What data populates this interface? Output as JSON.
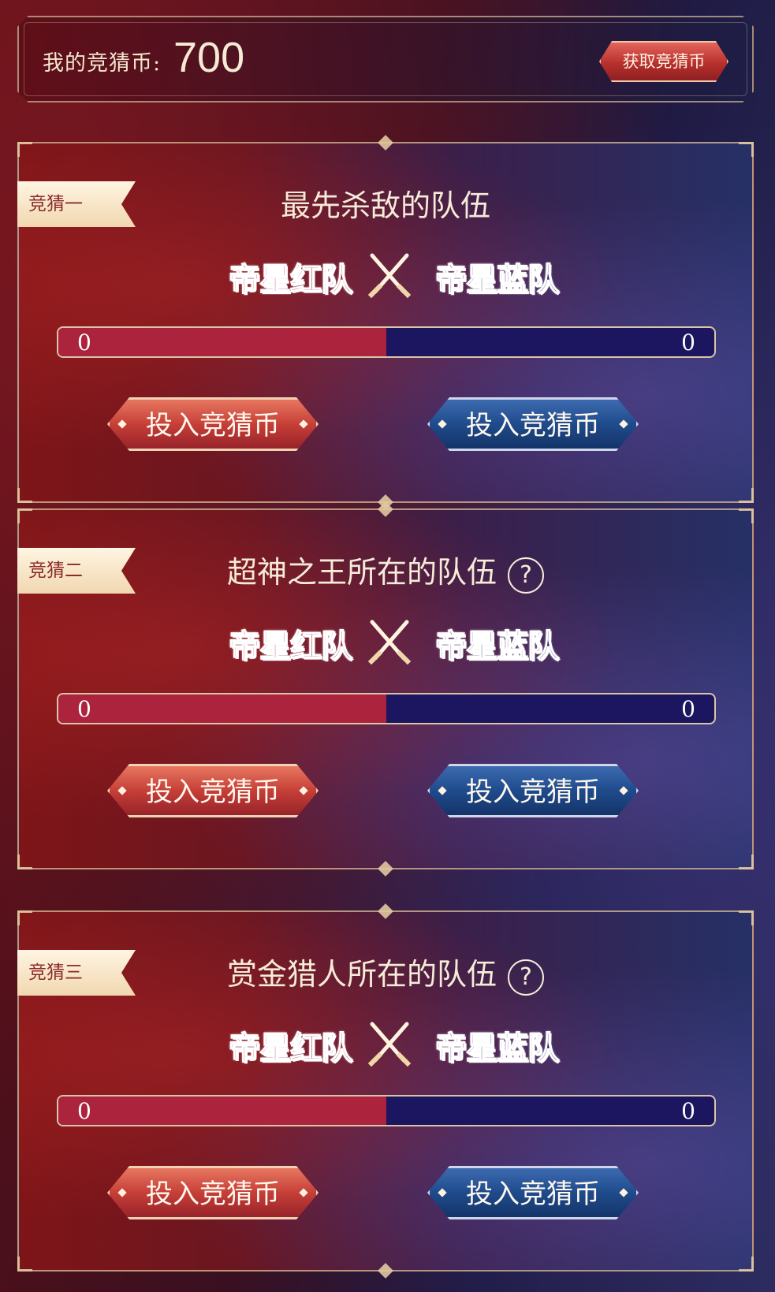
{
  "wallet": {
    "label": "我的竞猜币:",
    "coins": "700",
    "get_coins_button": "获取竞猜币"
  },
  "quizzes": [
    {
      "tag": "竞猜一",
      "question": "最先杀敌的队伍",
      "has_help": false,
      "red_team": "帝星红队",
      "blue_team": "帝星蓝队",
      "red_count": "0",
      "blue_count": "0",
      "red_share": 0.5,
      "red_button": "投入竞猜币",
      "blue_button": "投入竞猜币"
    },
    {
      "tag": "竞猜二",
      "question": "超神之王所在的队伍",
      "has_help": true,
      "help_glyph": "?",
      "red_team": "帝星红队",
      "blue_team": "帝星蓝队",
      "red_count": "0",
      "blue_count": "0",
      "red_share": 0.5,
      "red_button": "投入竞猜币",
      "blue_button": "投入竞猜币"
    },
    {
      "tag": "竞猜三",
      "question": "赏金猎人所在的队伍",
      "has_help": true,
      "help_glyph": "?",
      "red_team": "帝星红队",
      "blue_team": "帝星蓝队",
      "red_count": "0",
      "blue_count": "0",
      "red_share": 0.5,
      "red_button": "投入竞猜币",
      "blue_button": "投入竞猜币"
    }
  ],
  "colors": {
    "red_team": "#b21a3a",
    "blue_team": "#1d1e6a",
    "gold_border": "#d8c6a6"
  }
}
